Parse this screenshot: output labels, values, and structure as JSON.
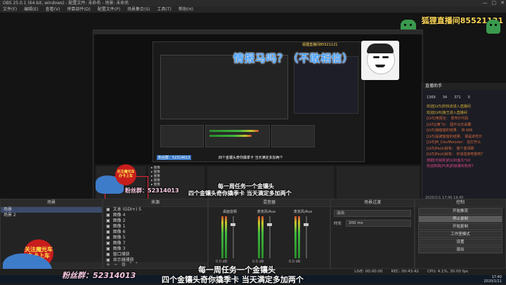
{
  "window": {
    "title": "OBS 25.0.1 (64-bit, windows) - 配置文件: 未命名 - 场景: 未命名",
    "controls": [
      "—",
      "▢",
      "✕"
    ]
  },
  "menu": [
    "文件(F)",
    "编辑(E)",
    "查看(V)",
    "停靠部件(D)",
    "配置文件(P)",
    "场景集合(S)",
    "工具(T)",
    "帮助(H)"
  ],
  "overlay": {
    "room_label": "狐狸直播间85521121",
    "room_label_small": "狐狸直播间85521121",
    "speech": "情报马吗？（不敢相信）",
    "fan_group": "粉丝群：52314013",
    "fan_group_small": "粉丝群：52314013",
    "fan_group_tiny": "粉丝群：52314013",
    "weekly_task": "每一周任务一个金镶头",
    "extra_task": "四个金镶头奇你撬季卡 当天满定多加两个",
    "weekly_task_small": "每一周任务一个金镶头",
    "extra_task_small": "四个金镶头奇你撬季卡 当天满定多加两个",
    "badge_line1": "关注魔光车",
    "badge_line2": "办卡上车",
    "badge_small_line1": "关注魔光车",
    "badge_small_line2": "办卡上车"
  },
  "chat": {
    "header": "直播助手",
    "stats": [
      "1369",
      "34",
      "371",
      "0"
    ],
    "lines": [
      {
        "kind": "sys",
        "text": "欢迎[LV5]你快去进入直播间"
      },
      {
        "kind": "sys",
        "text": "欢迎[LV6]狼王进入直播间"
      },
      {
        "kind": "msg",
        "text": "[LV5]电报全：   意传尔代码"
      },
      {
        "kind": "msg",
        "text": "[LV5](黄飞)：   圆中马天采藏"
      },
      {
        "kind": "msg",
        "text": "[LV5]弹窗窗的结果：   将 666"
      },
      {
        "kind": "msg",
        "text": "[LV5]是被窗窗的结果：   我是走吃什"
      },
      {
        "kind": "msg",
        "text": "[LV5]M_ClevMonster：   在打开么"
      },
      {
        "kind": "msg",
        "text": "[LV5]Pack|就有：   端个金领刷"
      },
      {
        "kind": "msg",
        "text": "[LV5]Pack|就有：   你该选家吧窗吧?"
      },
      {
        "kind": "gift",
        "text": "感谢[可就拼]的100鱼丸*10"
      },
      {
        "kind": "gift",
        "text": "欢迎高铁[PUB]的就被买粉奖?"
      }
    ],
    "footer": "2020/1/1 17:40  19:45"
  },
  "docks": {
    "scenes": {
      "title": "场景",
      "items": [
        "场景",
        "场景 2"
      ],
      "selected": 0
    },
    "sources": {
      "title": "来源",
      "items": [
        "文本 (GDI+) 5",
        "图像 4",
        "图像 2",
        "图像 1",
        "图像 6",
        "图像 5",
        "图像 7",
        "图像 3",
        "窗口捕获",
        "显示器捕获"
      ],
      "selected": -1
    },
    "mixer": {
      "title": "混音器",
      "channels": [
        {
          "name": "桌面音频",
          "value": "0.0 dB"
        },
        {
          "name": "麦克风/Aux",
          "value": "0.0 dB"
        },
        {
          "name": "麦克风/Aux",
          "value": "0.0 dB"
        }
      ]
    },
    "transitions": {
      "title": "场景过渡",
      "type": "淡出",
      "duration_label": "时长",
      "duration_value": "300 ms"
    },
    "controls": {
      "title": "控制",
      "buttons": [
        "开始推流",
        "停止录制",
        "开始复制",
        "工作室模式",
        "设置",
        "退出"
      ],
      "active": 1
    }
  },
  "status": {
    "live": "LIVE: 00:00:00",
    "rec": "REC: 00:43:42",
    "cpu": "CPU: 4.1%, 30.00 fps"
  },
  "taskbar": {
    "time": "17:40",
    "date": "2020/1/11"
  },
  "colors": {
    "speech": "#4aa3ff",
    "room": "#ffd75a",
    "badge_bg": "#c81d1d",
    "badge_text": "#ffe04a",
    "shark": "#3d7cc9",
    "dino": "#3a9a4d"
  }
}
